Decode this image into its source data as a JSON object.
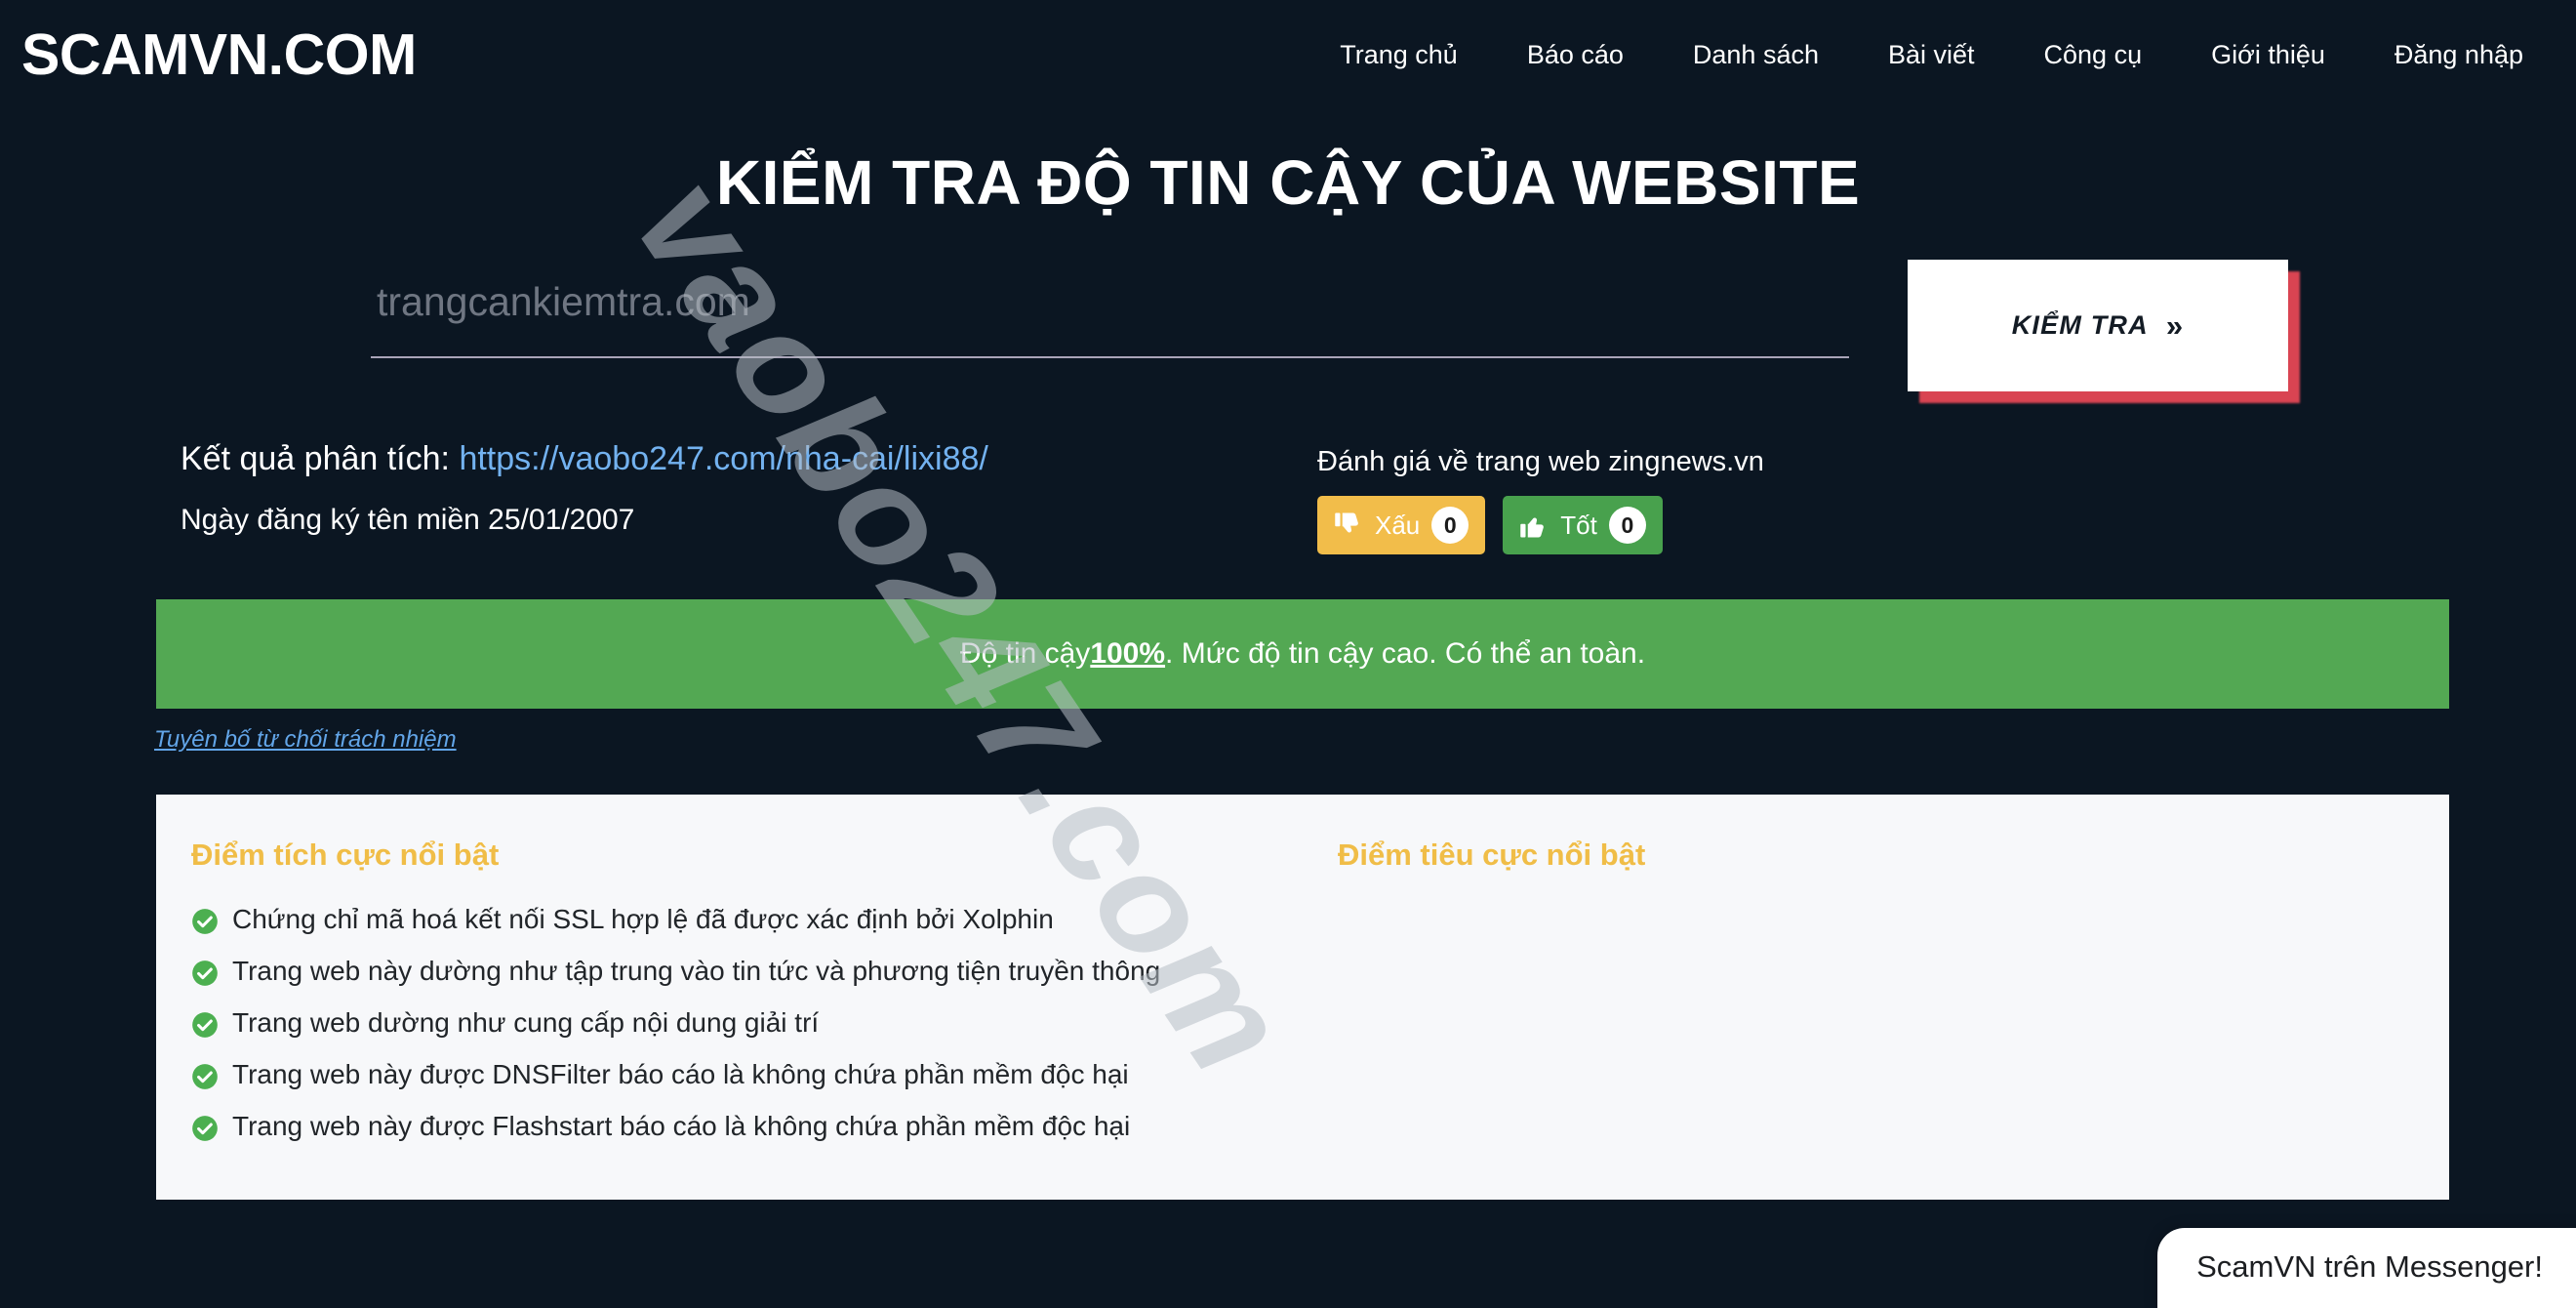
{
  "header": {
    "brand": "SCAMVN.COM",
    "nav": [
      {
        "label": "Trang chủ"
      },
      {
        "label": "Báo cáo"
      },
      {
        "label": "Danh sách"
      },
      {
        "label": "Bài viết"
      },
      {
        "label": "Công cụ"
      },
      {
        "label": "Giới thiệu"
      },
      {
        "label": "Đăng nhập"
      }
    ]
  },
  "hero": {
    "title": "KIỂM TRA ĐỘ TIN CẬY CỦA WEBSITE"
  },
  "search": {
    "value": "",
    "placeholder": "trangcankiemtra.com",
    "button_label": "KIỂM TRA",
    "button_chevron": "»"
  },
  "result": {
    "label": "Kết quả phân tích:",
    "url": "https://vaobo247.com/nha-cai/lixi88/",
    "domain_date": "Ngày đăng ký tên miền 25/01/2007"
  },
  "rating": {
    "heading": "Đánh giá về trang web zingnews.vn",
    "bad_label": "Xấu",
    "bad_count": "0",
    "bad_color": "#f2bd4a",
    "good_label": "Tốt",
    "good_count": "0",
    "good_color": "#48a14d"
  },
  "trust": {
    "prefix": "Độ tin cậy ",
    "score": "100%",
    "suffix": ". Mức độ tin cậy cao. Có thể an toàn.",
    "bar_color": "#53a853",
    "disclaimer": "Tuyên bố từ chối trách nhiệm"
  },
  "panels": {
    "positive": {
      "heading": "Điểm tích cực nổi bật",
      "items": [
        "Chứng chỉ mã hoá kết nối SSL hợp lệ đã được xác định bởi Xolphin",
        "Trang web này dường như tập trung vào tin tức và phương tiện truyền thông",
        "Trang web dường như cung cấp nội dung giải trí",
        "Trang web này được DNSFilter báo cáo là không chứa phần mềm độc hại",
        "Trang web này được Flashstart báo cáo là không chứa phần mềm độc hại"
      ]
    },
    "negative": {
      "heading": "Điểm tiêu cực nổi bật",
      "items": []
    },
    "accent_color": "#f0bd47"
  },
  "watermark": {
    "text": "vaobo247.com"
  },
  "messenger": {
    "label": "ScamVN trên Messenger!"
  }
}
